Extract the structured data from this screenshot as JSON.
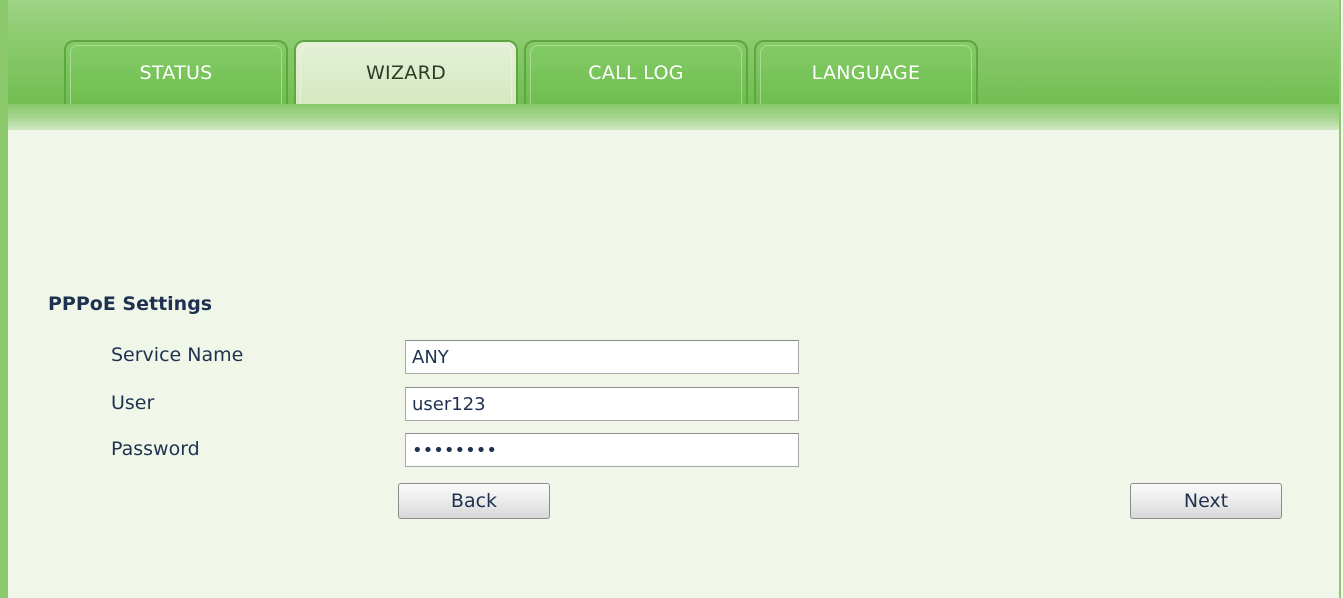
{
  "tabs": [
    {
      "label": "STATUS",
      "active": false
    },
    {
      "label": "WIZARD",
      "active": true
    },
    {
      "label": "CALL LOG",
      "active": false
    },
    {
      "label": "LANGUAGE",
      "active": false
    }
  ],
  "pppoe": {
    "title": "PPPoE Settings",
    "fields": {
      "service_name": {
        "label": "Service Name",
        "value": "ANY"
      },
      "user": {
        "label": "User",
        "value": "user123"
      },
      "password": {
        "label": "Password",
        "value": "passw0rd"
      }
    }
  },
  "buttons": {
    "back": "Back",
    "next": "Next"
  },
  "colors": {
    "header_green": "#72be52",
    "active_tab": "#d6e9c2",
    "content_bg": "#f0f6e8",
    "text_navy": "#1e3150"
  }
}
